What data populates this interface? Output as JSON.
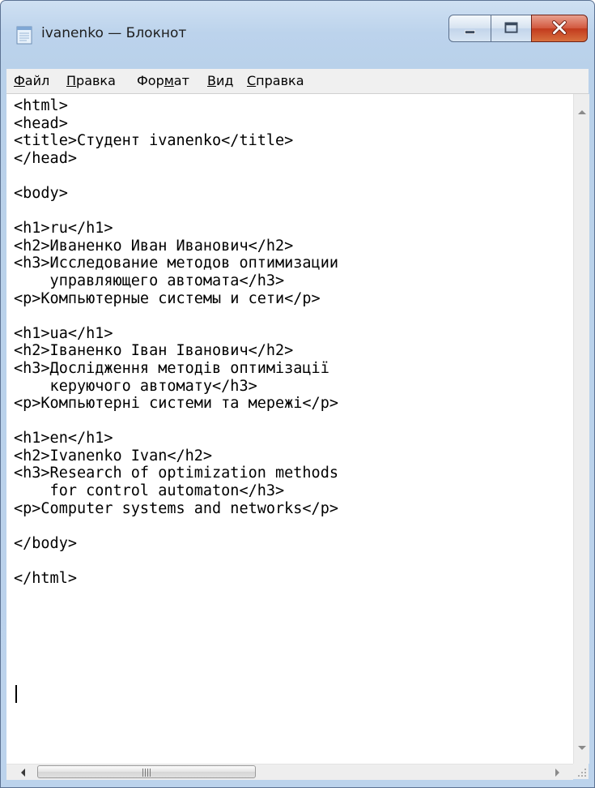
{
  "window": {
    "title": "ivanenko — Блокнот"
  },
  "menu": {
    "file": {
      "hot": "Ф",
      "rest": "айл"
    },
    "edit": {
      "hot": "П",
      "rest": "равка"
    },
    "format": {
      "pre": "Фор",
      "hot": "м",
      "post": "ат"
    },
    "view": {
      "hot": "В",
      "rest": "ид"
    },
    "help": {
      "hot": "С",
      "rest": "правка"
    }
  },
  "editor": {
    "text": "<html>\n<head>\n<title>Студент ivanenko</title>\n</head>\n\n<body>\n\n<h1>ru</h1>\n<h2>Иваненко Иван Иванович</h2>\n<h3>Исследование методов оптимизации\n    управляющего автомата</h3>\n<p>Компьютерные системы и сети</p>\n\n<h1>ua</h1>\n<h2>Іваненко Іван Іванович</h2>\n<h3>Дослідження методів оптимізації\n    керуючого автомату</h3>\n<p>Компьютерні системи та мережі</p>\n\n<h1>en</h1>\n<h2>Ivanenko Ivan</h2>\n<h3>Research of optimization methods\n    for control automaton</h3>\n<p>Computer systems and networks</p>\n\n</body>\n\n</html>\n"
  },
  "icons": {
    "app": "notepad-icon",
    "minimize": "minimize-icon",
    "maximize": "maximize-icon",
    "close": "close-icon"
  },
  "colors": {
    "close_button": "#c8452a",
    "frame": "#bcd3ec",
    "menubar": "#f0f0f0"
  }
}
